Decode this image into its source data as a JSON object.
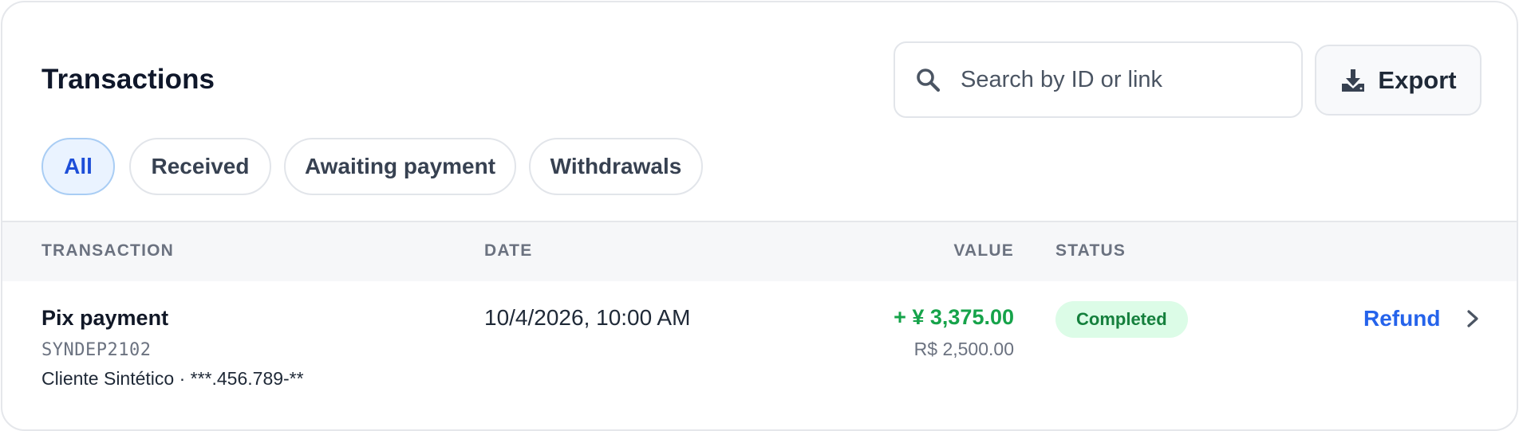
{
  "header": {
    "title": "Transactions",
    "search": {
      "placeholder": "Search by ID or link",
      "value": ""
    },
    "export_label": "Export"
  },
  "filters": [
    {
      "label": "All",
      "active": true
    },
    {
      "label": "Received",
      "active": false
    },
    {
      "label": "Awaiting payment",
      "active": false
    },
    {
      "label": "Withdrawals",
      "active": false
    }
  ],
  "table": {
    "columns": {
      "transaction": "TRANSACTION",
      "date": "DATE",
      "value": "VALUE",
      "status": "STATUS"
    },
    "rows": [
      {
        "name": "Pix payment",
        "id": "SYNDEP2102",
        "client": "Cliente Sintético · ***.456.789-**",
        "date": "10/4/2026, 10:00 AM",
        "value": "+ ¥ 3,375.00",
        "value_secondary": "R$ 2,500.00",
        "status": "Completed",
        "action": "Refund"
      }
    ]
  },
  "colors": {
    "accent": "#2563eb",
    "positive": "#16a34a",
    "status_completed_bg": "#dcfce7",
    "status_completed_text": "#15803d",
    "chip_active_bg": "#eaf3ff"
  },
  "icons": {
    "search": "search-icon",
    "export": "download-icon",
    "row_open": "chevron-right-icon"
  }
}
